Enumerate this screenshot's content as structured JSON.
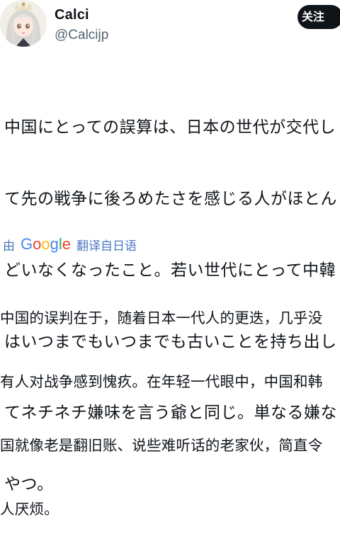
{
  "header": {
    "display_name": "Calci",
    "handle": "@Calcijp",
    "follow_label": "关注"
  },
  "tweet": {
    "lines": [
      "中国にとっての誤算は、日本の世代が交代し",
      "て先の戦争に後ろめたさを感じる人がほとん",
      "どいなくなったこと。若い世代にとって中韓",
      "はいつまでもいつまでも古いことを持ち出し",
      "てネチネチ嫌味を言う爺と同じ。単なる嫌な",
      "やつ。"
    ]
  },
  "translate": {
    "by": "由",
    "logo_letters": [
      "G",
      "o",
      "o",
      "g",
      "l",
      "e"
    ],
    "label": "翻译自日语"
  },
  "translation": {
    "lines": [
      "中国的误判在于，随着日本一代人的更迭，几乎没",
      "有人对战争感到愧疚。在年轻一代眼中，中国和韩",
      "国就像老是翻旧账、说些难听话的老家伙，简直令",
      "人厌烦。"
    ]
  },
  "colors": {
    "text": "#0f1419",
    "secondary": "#536471",
    "link": "#4b78c2",
    "button_bg": "#0f1419"
  },
  "icons": {
    "avatar": "anime-doll-avatar"
  }
}
